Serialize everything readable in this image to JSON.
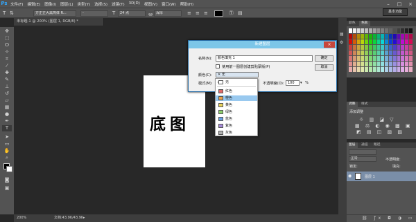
{
  "app": {
    "logo": "Ps",
    "menu": [
      "文件(F)",
      "编辑(E)",
      "图像(I)",
      "图层(L)",
      "类型(Y)",
      "选择(S)",
      "滤镜(T)",
      "3D(D)",
      "视图(V)",
      "窗口(W)",
      "帮助(H)"
    ],
    "window_buttons": [
      "–",
      "□",
      "×"
    ],
    "workspace": "基本功能"
  },
  "options_bar": {
    "tool_icon": "T",
    "font_family": "方正正大黑简体 R...",
    "font_style": "-",
    "font_size": "24 点",
    "antialias": "浑厚"
  },
  "document": {
    "tab": "未标题-1 @ 200% (图层 1, RGB/8) *",
    "canvas_text": "底图",
    "zoom": "200%",
    "doc_info": "文档:43.9K/43.9K"
  },
  "dialog": {
    "title": "新建图层",
    "close": "×",
    "name_label": "名称(N):",
    "name_value": "颜色填充 1",
    "ok": "确定",
    "cancel": "取消",
    "clip_label": "使用前一图层创建剪贴蒙版(P)",
    "color_label": "颜色(C):",
    "color_value": "无",
    "mode_label": "模式(M):",
    "opacity_label": "不透明度(O):",
    "opacity_value": "100",
    "opacity_unit": "%"
  },
  "color_options": [
    {
      "label": "无",
      "swatch": "#ffffff",
      "checked": true
    },
    {
      "label": "红色",
      "swatch": "#e06a6a"
    },
    {
      "label": "橙色",
      "swatch": "#e8a04a",
      "highlighted": true
    },
    {
      "label": "黄色",
      "swatch": "#e8d25a"
    },
    {
      "label": "绿色",
      "swatch": "#8ccf6a"
    },
    {
      "label": "蓝色",
      "swatch": "#6aa0e0"
    },
    {
      "label": "紫色",
      "swatch": "#a58ad8"
    },
    {
      "label": "灰色",
      "swatch": "#b0b0b0"
    }
  ],
  "panels": {
    "swatches_tabs": [
      "颜色",
      "色板"
    ],
    "adjust_tabs": [
      "调整",
      "样式"
    ],
    "adjust_title": "添加调整",
    "layers_tabs": [
      "图层",
      "通道",
      "路径"
    ],
    "blend_mode": "正常",
    "opacity_label": "不透明度:",
    "fill_label": "填充:",
    "lock_label": "锁定:",
    "layer_name": "图层 1"
  },
  "colors": {
    "ps_blue": "#31a8ff",
    "dialog_title": "#7cc6e8",
    "selected_layer": "#7a8ea8",
    "highlight": "#99c9ef"
  }
}
